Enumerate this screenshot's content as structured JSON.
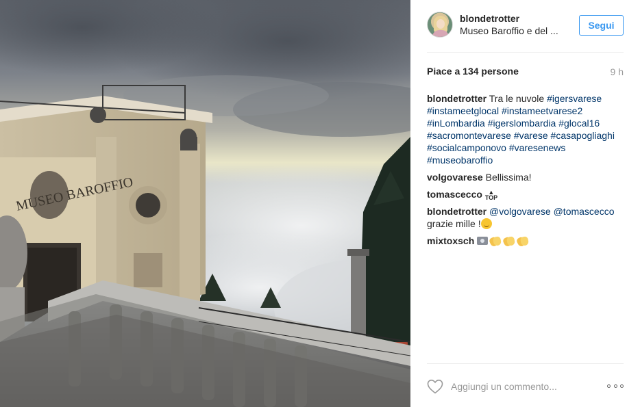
{
  "post": {
    "image_alt": "Museo Baroffio sopra le nuvole",
    "museum_sign": "MUSEO BAROFFIO"
  },
  "header": {
    "username": "blondetrotter",
    "location": "Museo Baroffio e del ...",
    "follow_label": "Segui"
  },
  "stats": {
    "likes": "Piace a 134 persone",
    "time": "9 h"
  },
  "comments": [
    {
      "user": "blondetrotter",
      "text": "Tra le nuvole",
      "hashtags": [
        "#igersvarese",
        "#instameetglocal",
        "#instameetvarese2",
        "#inLombardia",
        "#igerslombardia",
        "#glocal16",
        "#sacromontevarese",
        "#varese",
        "#casapogliaghi",
        "#socialcamponovo",
        "#varesenews",
        "#museobaroffio"
      ]
    },
    {
      "user": "volgovarese",
      "text": "Bellissima!"
    },
    {
      "user": "tomascecco",
      "emoji": "TOP"
    },
    {
      "user": "blondetrotter",
      "mentions": [
        "@volgovarese",
        "@tomascecco"
      ],
      "text": "grazie mille !"
    },
    {
      "user": "mixtoxsch"
    }
  ],
  "footer": {
    "comment_placeholder": "Aggiungi un commento..."
  },
  "icons": [
    "avatar",
    "heart-icon",
    "more-options-icon",
    "top-emoji-icon",
    "smile-emoji-icon",
    "camera-emoji-icon",
    "clapping-hands-emoji-icon"
  ],
  "colors": {
    "link": "#003569",
    "button": "#3897f0",
    "muted": "#999999",
    "text": "#262626",
    "divider": "#efefef"
  }
}
